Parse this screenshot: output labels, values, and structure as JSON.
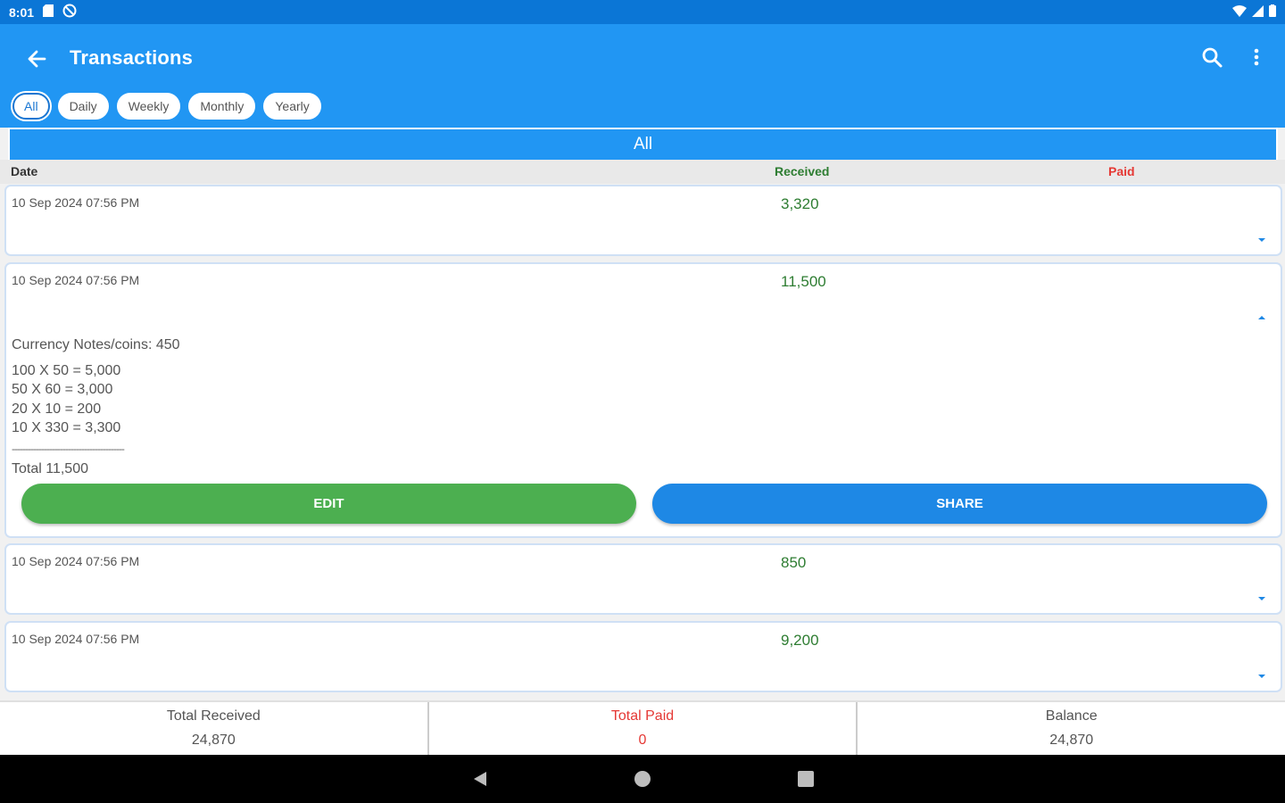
{
  "status_bar": {
    "time": "8:01",
    "icons": [
      "sd-card-icon",
      "no-sync-icon",
      "wifi-icon",
      "signal-icon",
      "battery-icon"
    ]
  },
  "app_bar": {
    "title": "Transactions",
    "icons": [
      "back-arrow-icon",
      "search-icon",
      "more-vert-icon"
    ]
  },
  "filters": {
    "chips": [
      "All",
      "Daily",
      "Weekly",
      "Monthly",
      "Yearly"
    ],
    "selected": "All"
  },
  "section_title": "All",
  "columns": {
    "date": "Date",
    "received": "Received",
    "paid": "Paid"
  },
  "transactions": [
    {
      "date": "10 Sep 2024 07:56 PM",
      "received": "3,320",
      "expanded": false
    },
    {
      "date": "10 Sep 2024 07:56 PM",
      "received": "11,500",
      "expanded": true,
      "details": {
        "header": "Currency Notes/coins: 450",
        "lines": [
          "100 X 50 = 5,000",
          "50 X 60 = 3,000",
          "20 X 10 = 200",
          "10 X 330 = 3,300"
        ],
        "separator": "------------------------------------------",
        "total": "Total 11,500"
      },
      "edit_label": "EDIT",
      "share_label": "SHARE"
    },
    {
      "date": "10 Sep 2024 07:56 PM",
      "received": "850",
      "expanded": false
    },
    {
      "date": "10 Sep 2024 07:56 PM",
      "received": "9,200",
      "expanded": false
    }
  ],
  "summary": {
    "total_received_label": "Total Received",
    "total_received": "24,870",
    "total_paid_label": "Total Paid",
    "total_paid": "0",
    "balance_label": "Balance",
    "balance": "24,870"
  },
  "colors": {
    "primary": "#2196f3",
    "status_bar": "#0b76d6",
    "received": "#2e7d32",
    "paid": "#e53935",
    "edit": "#4caf50",
    "share": "#1e88e5"
  }
}
